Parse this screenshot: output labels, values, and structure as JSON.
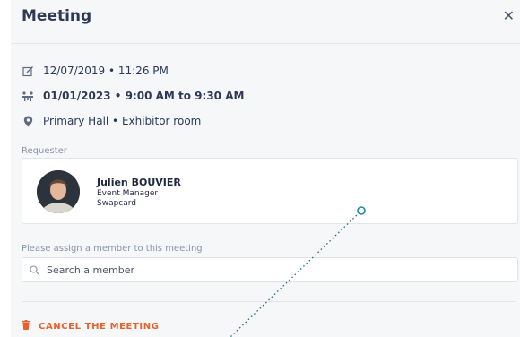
{
  "header": {
    "title": "Meeting",
    "close_label": "✕"
  },
  "details": {
    "created": "12/07/2019 • 11:26 PM",
    "schedule": "01/01/2023 • 9:00 AM to 9:30 AM",
    "location": "Primary Hall • Exhibitor room"
  },
  "requester": {
    "section_label": "Requester",
    "name": "Julien BOUVIER",
    "role": "Event Manager",
    "company": "Swapcard"
  },
  "assign": {
    "label": "Please assign a member to this meeting",
    "search_placeholder": "Search a member",
    "search_value": ""
  },
  "actions": {
    "cancel_label": "CANCEL THE MEETING"
  },
  "colors": {
    "accent": "#e8612c",
    "annotation": "#1a8a96",
    "title": "#2c3a57"
  }
}
